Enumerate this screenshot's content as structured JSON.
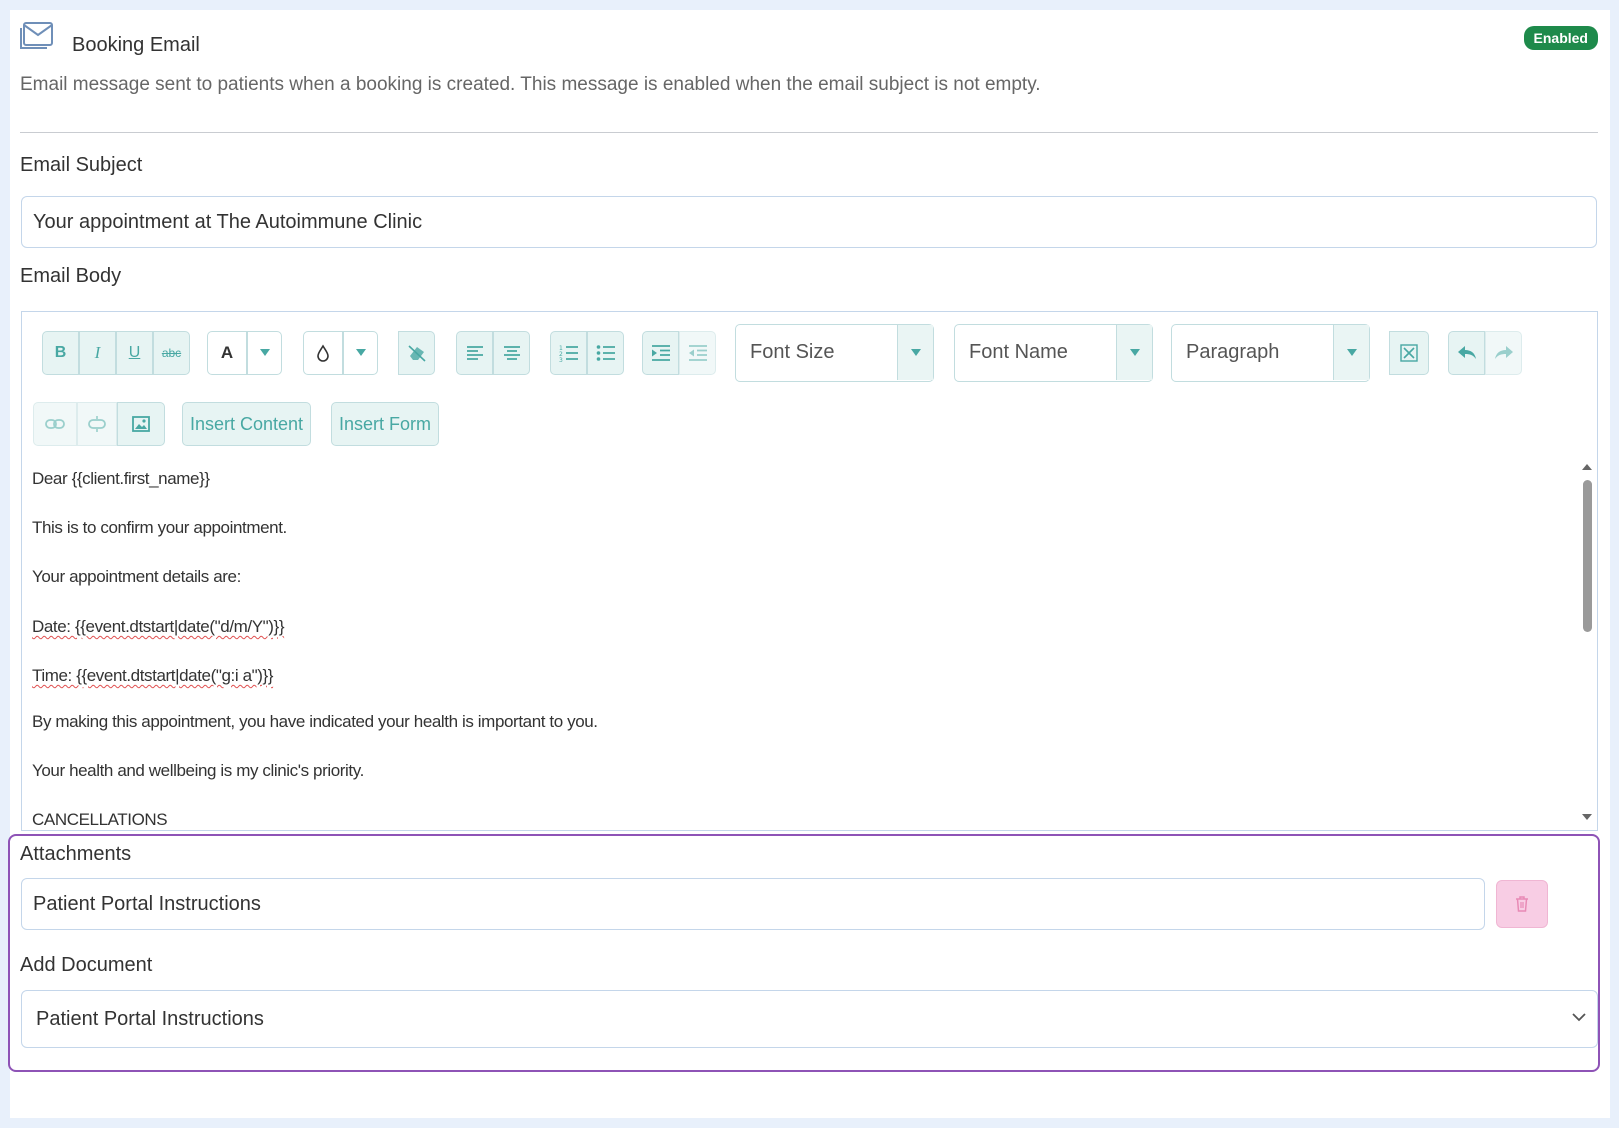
{
  "header": {
    "icon": "envelope-icon",
    "title": "Booking Email",
    "badge": "Enabled",
    "badge_color": "#1e8a4b",
    "description": "Email message sent to patients when a booking is created. This message is enabled when the email subject is not empty."
  },
  "subject": {
    "label": "Email Subject",
    "value": "Your appointment at The Autoimmune Clinic"
  },
  "body": {
    "label": "Email Body",
    "toolbar": {
      "bold": "B",
      "italic": "I",
      "underline": "U",
      "strikethrough": "abc",
      "font_color": "A",
      "font_size": "Font Size",
      "font_name": "Font Name",
      "paragraph": "Paragraph",
      "insert_content": "Insert Content",
      "insert_form": "Insert Form"
    },
    "lines": [
      "Dear {{client.first_name}}",
      "This is to confirm your appointment.",
      "Your appointment details are:",
      "Date: {{event.dtstart|date(\"d/m/Y\")}}",
      "Time: {{event.dtstart|date(\"g:i a\")}}",
      "By making this appointment, you have indicated your health is important to you.",
      "Your health and wellbeing is my clinic's priority.",
      "CANCELLATIONS"
    ]
  },
  "attachments": {
    "label": "Attachments",
    "value": "Patient Portal Instructions"
  },
  "add_document": {
    "label": "Add Document",
    "selected": "Patient Portal Instructions"
  },
  "colors": {
    "accent": "#48a8a3",
    "highlight_border": "#8e53b6",
    "delete_bg": "#f8cde4"
  }
}
